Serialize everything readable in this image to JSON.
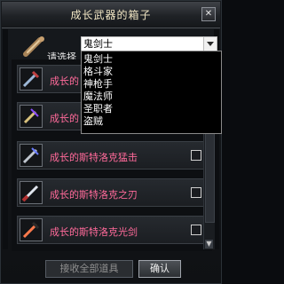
{
  "window": {
    "title": "成长武器的箱子",
    "close_label": "✕"
  },
  "select": {
    "label": "请选择",
    "value": "鬼剑士",
    "options": [
      "鬼剑士",
      "格斗家",
      "神枪手",
      "魔法师",
      "圣职者",
      "盗贼"
    ]
  },
  "items": [
    {
      "name": "成长的"
    },
    {
      "name": "成长的"
    },
    {
      "name": "成长的斯特洛克猛击"
    },
    {
      "name": "成长的斯特洛克之刃"
    },
    {
      "name": "成长的斯特洛克光剑"
    }
  ],
  "footer": {
    "receive_all_label": "接收全部道具",
    "confirm_label": "确认"
  },
  "colors": {
    "item_name": "#ff6a9a",
    "title": "#f1e6c4"
  },
  "icons": [
    "scroll-icon",
    "sword-icon",
    "close-icon",
    "chevron-down-icon"
  ]
}
